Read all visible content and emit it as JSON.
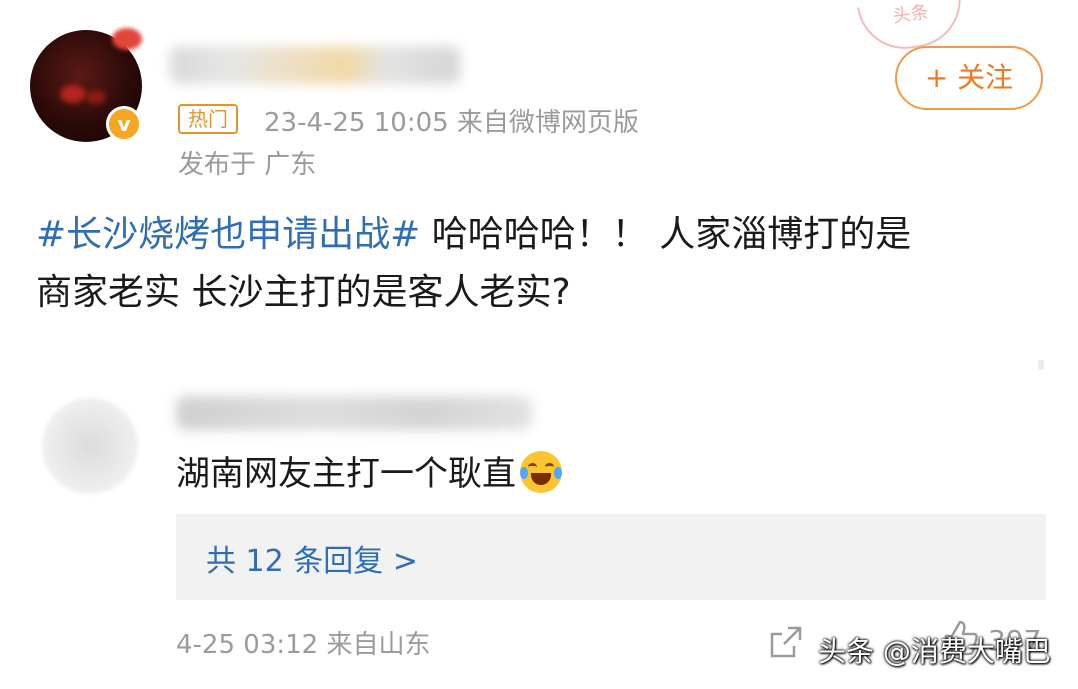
{
  "post": {
    "hot_tag": "热门",
    "meta": "23-4-25 10:05  来自微博网页版",
    "location": "发布于 广东",
    "follow_label": "+ 关注",
    "verified_mark": "v",
    "body_hashtag": "#长沙烧烤也申请出战#",
    "body_line1_rest": " 哈哈哈哈！！ 人家淄博打的是",
    "body_line2": "商家老实 长沙主打的是客人老实?"
  },
  "stamp": {
    "text": "头条"
  },
  "comment": {
    "text": "湖南网友主打一个耿直",
    "emoji": "laughing-crying-emoji",
    "replies_label": "共 12 条回复 >",
    "meta": "4-25 03:12  来自山东",
    "like_count": "397"
  },
  "watermark": {
    "text": "头条 @消费大嘴巴"
  },
  "colors": {
    "link_blue": "#2f6db4",
    "accent_orange": "#f07a1e",
    "meta_gray": "#9b9b9b",
    "reply_bg": "#f2f2f2"
  }
}
